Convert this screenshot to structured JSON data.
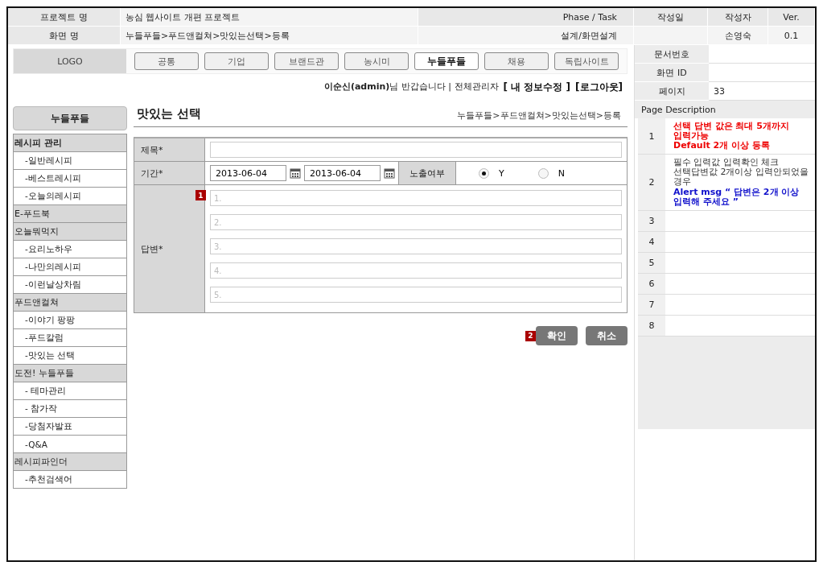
{
  "header": {
    "rows": [
      [
        {
          "kind": "label",
          "text": "프로젝트 명"
        },
        {
          "kind": "value",
          "text": "농심 웹사이트 개편 프로젝트"
        },
        {
          "kind": "label",
          "text": "Phase / Task"
        },
        {
          "kind": "label",
          "text": "작성일"
        },
        {
          "kind": "label",
          "text": "작성자"
        },
        {
          "kind": "label",
          "text": "Ver."
        }
      ],
      [
        {
          "kind": "label",
          "text": "화면 명"
        },
        {
          "kind": "value",
          "text": "누들푸들>푸드앤컬쳐>맛있는선택>등록"
        },
        {
          "kind": "value",
          "text": "설계/화면설계"
        },
        {
          "kind": "value"
        },
        {
          "kind": "value",
          "text": "손영숙"
        },
        {
          "kind": "value",
          "text": "0.1"
        }
      ]
    ]
  },
  "meta": [
    {
      "label": "문서번호"
    },
    {
      "label": "화면 ID"
    },
    {
      "label": "페이지",
      "value": "33"
    }
  ],
  "description": {
    "title": "Page Description",
    "rows": [
      {
        "number": "1",
        "lines": [
          {
            "kind": "warning",
            "text": "선택 답변 값은 최대 5개까지"
          },
          {
            "kind": "warning",
            "text": "입력가능"
          },
          {
            "kind": "warning",
            "text": "Default 2개 이상 등록"
          }
        ]
      },
      {
        "number": "2",
        "lines": [
          {
            "kind": "plain",
            "text": "필수 입력값 입력확인 체크"
          },
          {
            "kind": "plain",
            "text": "선택답변값 2개이상 입력안되었을경우"
          },
          {
            "kind": "alert",
            "text": "Alert msg “ 답변은 2개 이상 입력해 주세요 ”"
          }
        ]
      },
      {
        "number": "3"
      },
      {
        "number": "4"
      },
      {
        "number": "5"
      },
      {
        "number": "6"
      },
      {
        "number": "7"
      },
      {
        "number": "8"
      }
    ]
  },
  "logo": "LOGO",
  "tabs": [
    {
      "label": "공통",
      "selected": false
    },
    {
      "label": "기업",
      "selected": false
    },
    {
      "label": "브랜드관",
      "selected": false
    },
    {
      "label": "농시미",
      "selected": false
    },
    {
      "label": "누들푸들",
      "selected": true
    },
    {
      "label": "채용",
      "selected": false
    },
    {
      "label": "독립사이트",
      "selected": false
    }
  ],
  "user_bar": {
    "user": "이순신(admin)",
    "greeting": "님 반갑습니다 | 전체관리자",
    "edit_link": "[ 내 정보수정 ]",
    "logout_link": "[로그아웃]"
  },
  "sidebar": {
    "title": "누들푸들",
    "groups": [
      {
        "label": "레시피 관리",
        "children": [
          {
            "label": "-일반레시피"
          },
          {
            "label": "-베스트레시피"
          },
          {
            "label": "-오늘의레시피"
          }
        ]
      },
      {
        "label": "E-푸드북"
      },
      {
        "label": "오늘뭐먹지",
        "children": [
          {
            "label": "-요리노하우"
          },
          {
            "label": "-나만의레시피"
          },
          {
            "label": "-이런날상차림"
          }
        ]
      },
      {
        "label": "푸드앤컬쳐",
        "children": [
          {
            "label": "-이야기 팡팡"
          },
          {
            "label": "-푸드칼럼"
          },
          {
            "label": "-맛있는 선택"
          }
        ]
      },
      {
        "label": "도전! 누들푸들",
        "children": [
          {
            "label": "- 테마관리"
          },
          {
            "label": "- 참가작"
          },
          {
            "label": "-당첨자발표"
          },
          {
            "label": "-Q&A"
          }
        ]
      },
      {
        "label": "레시피파인더",
        "children": [
          {
            "label": "-추천검색어"
          }
        ]
      }
    ]
  },
  "page": {
    "title": "맛있는 선택",
    "breadcrumb": "누들푸들>푸드앤컬쳐>맛있는선택>등록"
  },
  "form": {
    "title_label": "제목*",
    "period_label": "기간*",
    "start_date": "2013-06-04",
    "end_date": "2013-06-04",
    "exposure_label": "노출여부",
    "exposure_options": [
      {
        "label": "Y",
        "selected": true
      },
      {
        "label": "N",
        "selected": false
      }
    ],
    "answer_label": "답변*",
    "answer_marker": "1",
    "answers": [
      {
        "placeholder": "1."
      },
      {
        "placeholder": "2."
      },
      {
        "placeholder": "3."
      },
      {
        "placeholder": "4."
      },
      {
        "placeholder": "5."
      }
    ]
  },
  "actions": {
    "marker": "2",
    "buttons": [
      {
        "kind": "primary",
        "label": "확인"
      },
      {
        "kind": "secondary",
        "label": "취소"
      }
    ]
  }
}
